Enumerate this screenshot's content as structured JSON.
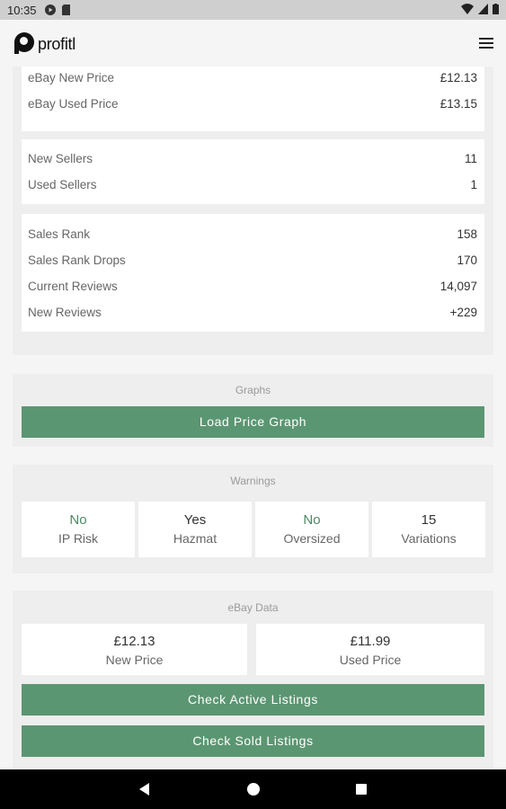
{
  "status_bar": {
    "time": "10:35",
    "icons": [
      "media-icon",
      "sd-card-icon",
      "wifi-icon",
      "signal-icon",
      "battery-icon"
    ]
  },
  "header": {
    "logo_text": "profitl",
    "menu_icon": "hamburger-menu-icon"
  },
  "price_card": {
    "rows": [
      {
        "label": "eBay New Price",
        "value": "£12.13"
      },
      {
        "label": "eBay Used Price",
        "value": "£13.15"
      }
    ]
  },
  "sellers_card": {
    "rows": [
      {
        "label": "New Sellers",
        "value": "11"
      },
      {
        "label": "Used Sellers",
        "value": "1"
      }
    ]
  },
  "rank_card": {
    "rows": [
      {
        "label": "Sales Rank",
        "value": "158"
      },
      {
        "label": "Sales Rank Drops",
        "value": "170"
      },
      {
        "label": "Current Reviews",
        "value": "14,097"
      },
      {
        "label": "New Reviews",
        "value": "+229"
      }
    ]
  },
  "graphs": {
    "title": "Graphs",
    "button": "Load Price Graph"
  },
  "warnings": {
    "title": "Warnings",
    "items": [
      {
        "value": "No",
        "label": "IP Risk",
        "color": "#4b8a63"
      },
      {
        "value": "Yes",
        "label": "Hazmat",
        "color": "#333333"
      },
      {
        "value": "No",
        "label": "Oversized",
        "color": "#4b8a63"
      },
      {
        "value": "15",
        "label": "Variations",
        "color": "#333333"
      }
    ]
  },
  "ebay": {
    "title": "eBay Data",
    "new_price": {
      "value": "£12.13",
      "label": "New Price"
    },
    "used_price": {
      "value": "£11.99",
      "label": "Used Price"
    },
    "active_button": "Check Active Listings",
    "sold_button": "Check Sold Listings"
  },
  "colors": {
    "accent_green": "#5b9672",
    "background": "#f5f5f5"
  },
  "nav_bar": {
    "icons": [
      "back-icon",
      "home-icon",
      "recents-icon"
    ]
  }
}
